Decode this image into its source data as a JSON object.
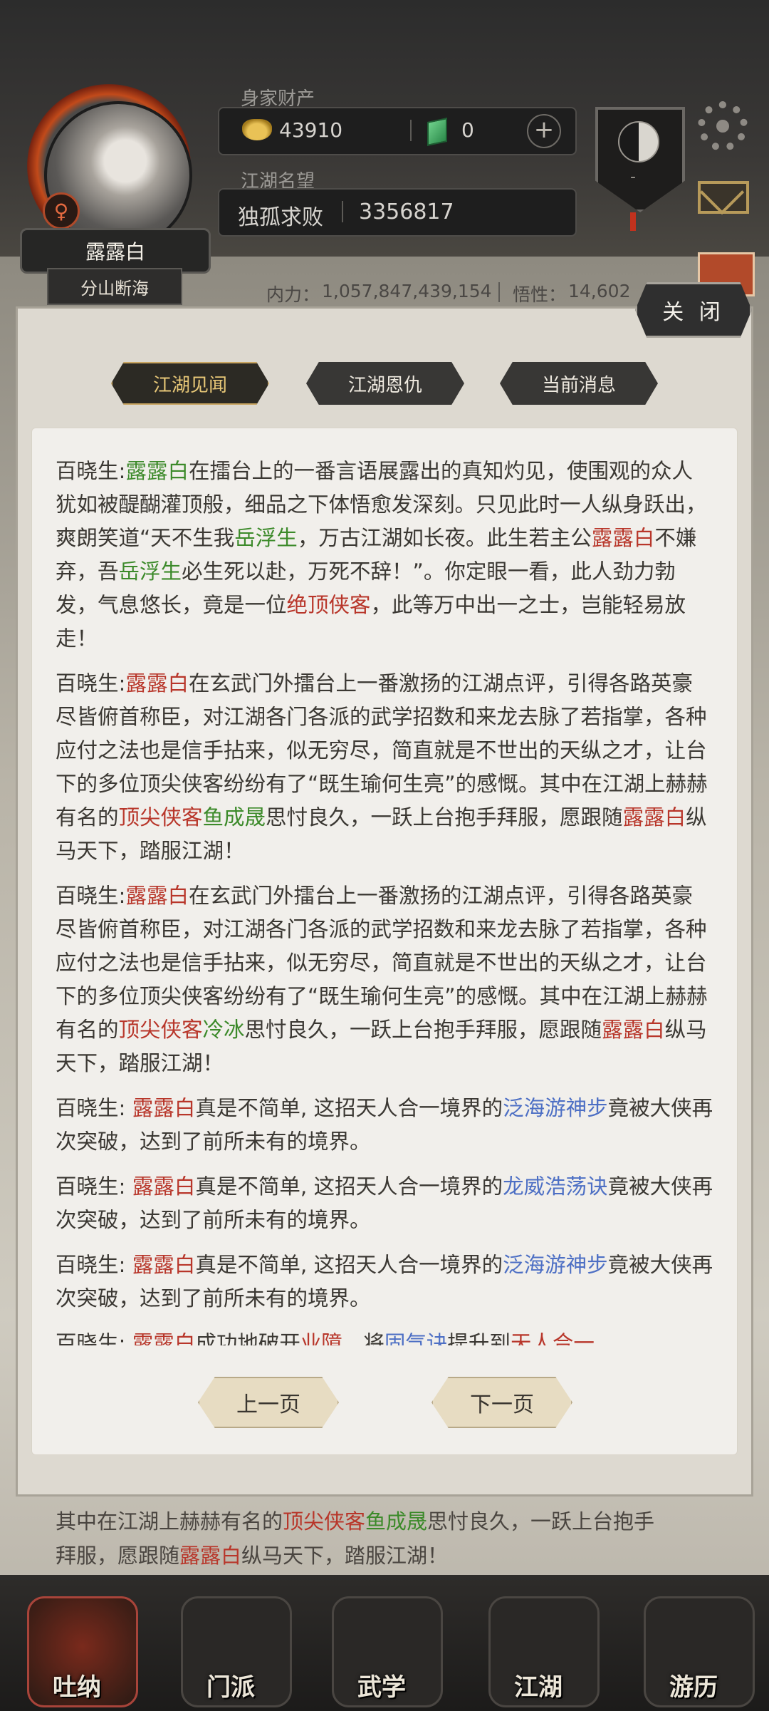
{
  "player": {
    "name": "露露白",
    "title": "分山断海",
    "gender_symbol": "♀"
  },
  "wealth": {
    "label": "身家财产",
    "gold": "43910",
    "jade": "0",
    "plus": "+"
  },
  "fame": {
    "label": "江湖名望",
    "rank": "独孤求败",
    "value": "3356817"
  },
  "emblem_mark": "-",
  "stats": {
    "inner_power_label": "内力：",
    "inner_power": "1,057,847,439,154",
    "insight_label": "悟性：",
    "insight": "14,602"
  },
  "panel": {
    "close_label": "关 闭",
    "tabs": [
      "江湖见闻",
      "江湖恩仇",
      "当前消息"
    ],
    "active_tab": 0,
    "prev_label": "上一页",
    "next_label": "下一页"
  },
  "messages": [
    {
      "segments": [
        {
          "t": "百晓生:"
        },
        {
          "t": "露露白",
          "c": "g"
        },
        {
          "t": "在擂台上的一番言语展露出的真知灼见，使围观的众人犹如被醍醐灌顶般，细品之下体悟愈发深刻。只见此时一人纵身跃出，爽朗笑道“天不生我"
        },
        {
          "t": "岳浮生",
          "c": "g"
        },
        {
          "t": "，万古江湖如长夜。此生若主公"
        },
        {
          "t": "露露白",
          "c": "n"
        },
        {
          "t": "不嫌弃，吾"
        },
        {
          "t": "岳浮生",
          "c": "g"
        },
        {
          "t": "必生死以赴，万死不辞！”。你定眼一看，此人劲力勃发，气息悠长，竟是一位"
        },
        {
          "t": "绝顶侠客",
          "c": "n"
        },
        {
          "t": "，此等万中出一之士，岂能轻易放走！"
        }
      ]
    },
    {
      "segments": [
        {
          "t": "百晓生:"
        },
        {
          "t": "露露白",
          "c": "n"
        },
        {
          "t": "在玄武门外擂台上一番激扬的江湖点评，引得各路英豪尽皆俯首称臣，对江湖各门各派的武学招数和来龙去脉了若指掌，各种应付之法也是信手拈来，似无穷尽，简直就是不世出的天纵之才，让台下的多位顶尖侠客纷纷有了“既生瑜何生亮”的感慨。其中在江湖上赫赫有名的"
        },
        {
          "t": "顶尖侠客",
          "c": "n"
        },
        {
          "t": "鱼成晟",
          "c": "g"
        },
        {
          "t": "思忖良久，一跃上台抱手拜服，愿跟随"
        },
        {
          "t": "露露白",
          "c": "n"
        },
        {
          "t": "纵马天下，踏服江湖！"
        }
      ]
    },
    {
      "segments": [
        {
          "t": "百晓生:"
        },
        {
          "t": "露露白",
          "c": "n"
        },
        {
          "t": "在玄武门外擂台上一番激扬的江湖点评，引得各路英豪尽皆俯首称臣，对江湖各门各派的武学招数和来龙去脉了若指掌，各种应付之法也是信手拈来，似无穷尽，简直就是不世出的天纵之才，让台下的多位顶尖侠客纷纷有了“既生瑜何生亮”的感慨。其中在江湖上赫赫有名的"
        },
        {
          "t": "顶尖侠客",
          "c": "n"
        },
        {
          "t": "冷冰",
          "c": "g"
        },
        {
          "t": "思忖良久，一跃上台抱手拜服，愿跟随"
        },
        {
          "t": "露露白",
          "c": "n"
        },
        {
          "t": "纵马天下，踏服江湖！"
        }
      ]
    },
    {
      "segments": [
        {
          "t": "百晓生: "
        },
        {
          "t": "露露白",
          "c": "n"
        },
        {
          "t": "真是不简单, 这招天人合一境界的"
        },
        {
          "t": "泛海游神步",
          "c": "b"
        },
        {
          "t": "竟被大侠再次突破，达到了前所未有的境界。"
        }
      ]
    },
    {
      "segments": [
        {
          "t": "百晓生: "
        },
        {
          "t": "露露白",
          "c": "n"
        },
        {
          "t": "真是不简单, 这招天人合一境界的"
        },
        {
          "t": "龙威浩荡诀",
          "c": "b"
        },
        {
          "t": "竟被大侠再次突破，达到了前所未有的境界。"
        }
      ]
    },
    {
      "segments": [
        {
          "t": "百晓生: "
        },
        {
          "t": "露露白",
          "c": "n"
        },
        {
          "t": "真是不简单, 这招天人合一境界的"
        },
        {
          "t": "泛海游神步",
          "c": "b"
        },
        {
          "t": "竟被大侠再次突破，达到了前所未有的境界。"
        }
      ]
    },
    {
      "segments": [
        {
          "t": "百晓生: "
        },
        {
          "t": "露露白",
          "c": "n"
        },
        {
          "t": "成功地破开"
        },
        {
          "t": "业障",
          "c": "n"
        },
        {
          "t": "，将"
        },
        {
          "t": "固气诀",
          "c": "b"
        },
        {
          "t": "提升到"
        },
        {
          "t": "天人合一",
          "c": "n"
        },
        {
          "t": "。"
        }
      ]
    }
  ],
  "behind_text": [
    "其中在江湖上赫赫有名的",
    "顶尖侠客",
    "鱼成晟",
    "思忖良久，一跃上台抱手",
    "拜服，愿跟随",
    "露露白",
    "纵马天下，踏服江湖！"
  ],
  "nav": [
    {
      "label": "吐纳",
      "icon": "meditation-icon"
    },
    {
      "label": "门派",
      "icon": "sect-flag-icon"
    },
    {
      "label": "武学",
      "icon": "martial-book-icon"
    },
    {
      "label": "江湖",
      "icon": "bamboo-hat-icon"
    },
    {
      "label": "游历",
      "icon": "horse-icon"
    }
  ],
  "colors": {
    "name_red": "#b8362a",
    "hero_green": "#3c8a2a",
    "skill_blue": "#4d6fc4",
    "tab_gold": "#e7c777"
  }
}
